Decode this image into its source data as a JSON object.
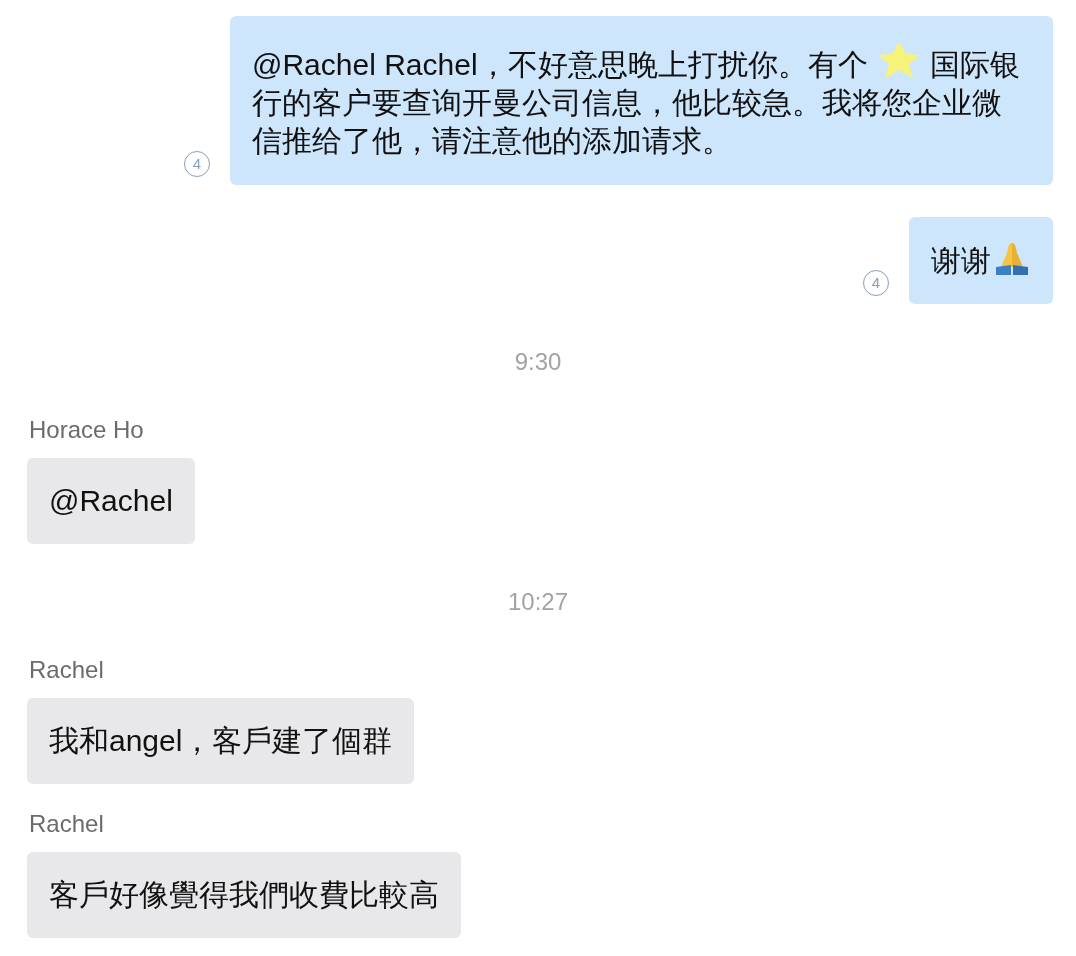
{
  "messages": [
    {
      "kind": "outgoing",
      "segments": [
        {
          "kind": "text",
          "text": "@Rachel  Rachel，不好意思晚上打扰你。有个"
        },
        {
          "kind": "sticker"
        },
        {
          "kind": "text",
          "text": "国际银行的客户要查询开曼公司信息，他比较急。我将您企业微信推给了他，请注意他的添加请求。"
        }
      ],
      "read_count": "4"
    },
    {
      "kind": "outgoing",
      "segments": [
        {
          "kind": "text",
          "text": "谢谢"
        },
        {
          "kind": "hands"
        }
      ],
      "read_count": "4"
    },
    {
      "kind": "time",
      "text": "9:30"
    },
    {
      "kind": "incoming",
      "sender": "Horace Ho",
      "segments": [
        {
          "kind": "text",
          "text": "@Rachel"
        }
      ]
    },
    {
      "kind": "time",
      "text": "10:27"
    },
    {
      "kind": "incoming",
      "sender": "Rachel",
      "segments": [
        {
          "kind": "text",
          "text": "我和angel，客戶建了個群"
        }
      ]
    },
    {
      "kind": "incoming",
      "sender": "Rachel",
      "segments": [
        {
          "kind": "text",
          "text": "客戶好像覺得我們收費比較高"
        }
      ]
    }
  ]
}
